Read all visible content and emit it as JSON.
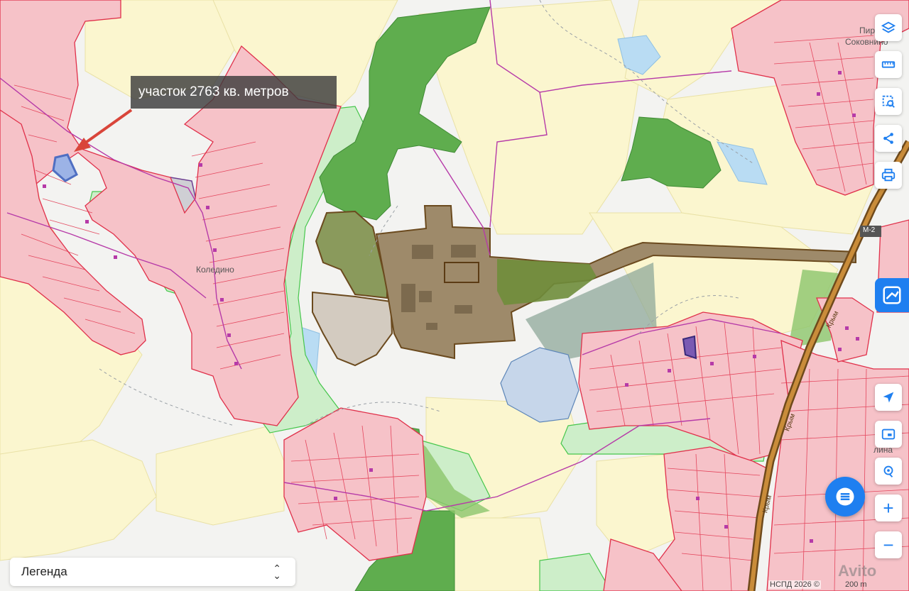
{
  "annotation": {
    "text": "участок 2763 кв. метров"
  },
  "labels": {
    "kolodino": "Коледино",
    "pirogova": "Пирогова",
    "sokovnino": "Соковнино",
    "road_m2": "М-2",
    "krym_1": "Крым",
    "krym_2": "Крым",
    "krym_3": "Крым",
    "lin": "лина"
  },
  "legend": {
    "label": "Легенда"
  },
  "attribution": "НСПД 2026 ©",
  "scale": "200 m",
  "watermark": "Avito",
  "toolbar": {
    "layers": "layers-icon",
    "ruler": "ruler-icon",
    "select": "select-area-icon",
    "share": "share-icon",
    "print": "print-icon",
    "locate": "navigation-arrow-icon",
    "screen": "screen-icon",
    "geo": "geo-pin-icon",
    "zoom_in": "+",
    "zoom_out": "−"
  },
  "colors": {
    "settlement_fill": "#f6c2c8",
    "settlement_stroke": "#e0304a",
    "forest": "#5fad4e",
    "agri": "#fbf6cf",
    "industrial": "#a08c6d",
    "water": "#b7dcf2",
    "road": "#9c6b2e",
    "accent": "#1e7ff0"
  }
}
